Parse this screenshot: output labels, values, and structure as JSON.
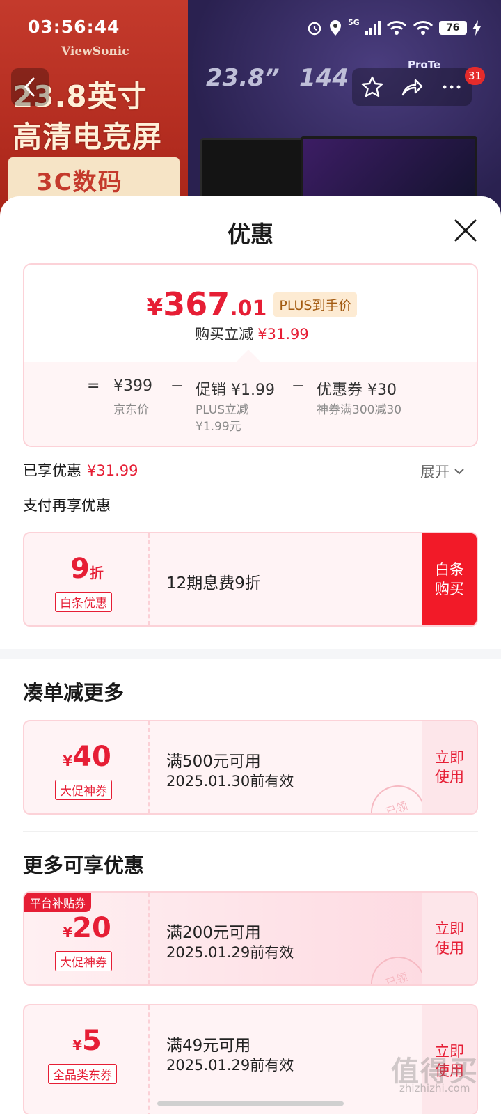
{
  "status_bar": {
    "time": "03:56:44",
    "network": "5G",
    "battery": "76"
  },
  "banner": {
    "brand": "ViewSonic",
    "promo_line1": "23.8英寸",
    "promo_line2": "高清电竞屏",
    "promo_line3": "3C数码",
    "spec_size": "23.8”",
    "spec_hz": "144",
    "eye_logo": "ProTe",
    "cart_count": "31"
  },
  "sheet": {
    "title": "优惠",
    "price": {
      "symbol": "¥",
      "integer": "367",
      "decimal": ".01",
      "plus_tag": "PLUS到手价",
      "reduce_label": "购买立减",
      "reduce_amount": "¥31.99"
    },
    "formula": {
      "equals": "=",
      "base_price": "¥399",
      "base_label": "京东价",
      "minus1": "−",
      "promo": "促销 ¥1.99",
      "promo_label1": "PLUS立减",
      "promo_label2": "¥1.99元",
      "minus2": "−",
      "coupon": "优惠券 ¥30",
      "coupon_label": "神券满300减30"
    },
    "enjoyed_label": "已享优惠",
    "enjoyed_amount": "¥31.99",
    "expand_label": "展开",
    "pay_more_label": "支付再享优惠",
    "baitiao": {
      "value": "9",
      "unit": "折",
      "tag": "白条优惠",
      "desc": "12期息费9折",
      "action": "白条\n购买"
    },
    "section_more": "凑单减更多",
    "coupon1": {
      "symbol": "¥",
      "value": "40",
      "tag": "大促神券",
      "cond": "满500元可用",
      "valid": "2025.01.30前有效",
      "action": "立即\n使用",
      "stamp": "已领"
    },
    "section_extra": "更多可享优惠",
    "coupon2": {
      "badge": "平台补贴券",
      "symbol": "¥",
      "value": "20",
      "tag": "大促神券",
      "cond": "满200元可用",
      "valid": "2025.01.29前有效",
      "action": "立即\n使用",
      "stamp": "已领"
    },
    "coupon3": {
      "symbol": "¥",
      "value": "5",
      "tag": "全品类东券",
      "cond": "满49元可用",
      "valid": "2025.01.29前有效",
      "action": "立即\n使用"
    }
  },
  "watermark": {
    "main": "值得买",
    "sub": "zhizhizhi.com"
  },
  "colors": {
    "accent_red": "#e61e35",
    "plus_gold": "#a35b12",
    "card_border": "#fcd2d8"
  }
}
